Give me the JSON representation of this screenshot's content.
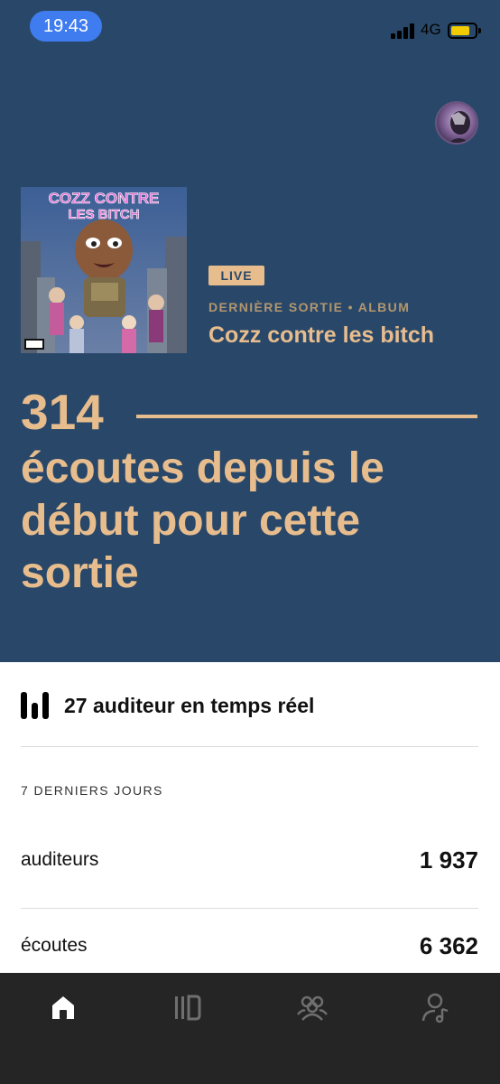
{
  "status_bar": {
    "time": "19:43",
    "network": "4G"
  },
  "colors": {
    "hero_bg": "#294869",
    "accent": "#e8bd8e",
    "tab_bar_bg": "#252525"
  },
  "header": {
    "avatar_icon": "user-avatar"
  },
  "album": {
    "cover_text_line1": "COZZ CONTRE",
    "cover_text_line2": "LES BITCH",
    "badge": "LIVE",
    "kind": "DERNIÈRE SORTIE • ALBUM",
    "title": "Cozz contre les bitch"
  },
  "hero": {
    "count": "314",
    "caption": "écoutes depuis le début pour cette sortie"
  },
  "realtime": {
    "icon": "equalizer-icon",
    "text": "27 auditeur en temps réel"
  },
  "last7": {
    "label": "7 DERNIERS JOURS",
    "rows": [
      {
        "label": "auditeurs",
        "value": "1 937"
      },
      {
        "label": "écoutes",
        "value": "6 362"
      }
    ]
  },
  "tabs": [
    {
      "icon": "home-icon",
      "active": true
    },
    {
      "icon": "library-icon",
      "active": false
    },
    {
      "icon": "audience-icon",
      "active": false
    },
    {
      "icon": "profile-music-icon",
      "active": false
    }
  ]
}
